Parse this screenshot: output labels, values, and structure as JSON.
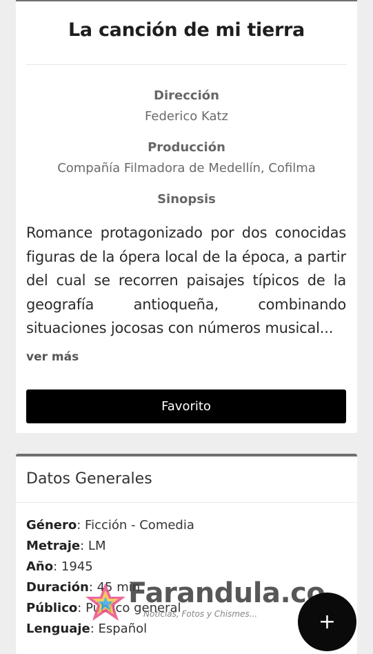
{
  "movie": {
    "title": "La canción de mi tierra",
    "direction_label": "Dirección",
    "direction_value": "Federico Katz",
    "production_label": "Producción",
    "production_value": "Compañía Filmadora de Medellín, Cofilma",
    "synopsis_label": "Sinopsis",
    "synopsis_text": "Romance protagonizado por dos conocidas figuras de la ópera local de la época, a partir del cual se recorren paisajes típicos de la geografía antioqueña, combinando situaciones jocosas con números musical...",
    "more_label": "ver más",
    "favorite_label": "Favorito"
  },
  "general": {
    "title": "Datos Generales",
    "fields": [
      {
        "key": "Género",
        "value": ": Ficción - Comedia"
      },
      {
        "key": "Metraje",
        "value": ": LM"
      },
      {
        "key": "Año",
        "value": ": 1945"
      },
      {
        "key": "Duración",
        "value": ": 45 min"
      },
      {
        "key": "Público",
        "value": ": Público general"
      },
      {
        "key": "Lenguaje",
        "value": ": Español"
      }
    ]
  },
  "watermark": {
    "brand": "Farandula.co",
    "tagline": "Noticias, Fotos y Chismes..."
  },
  "fab": {
    "icon": "plus-icon",
    "glyph": "+"
  }
}
